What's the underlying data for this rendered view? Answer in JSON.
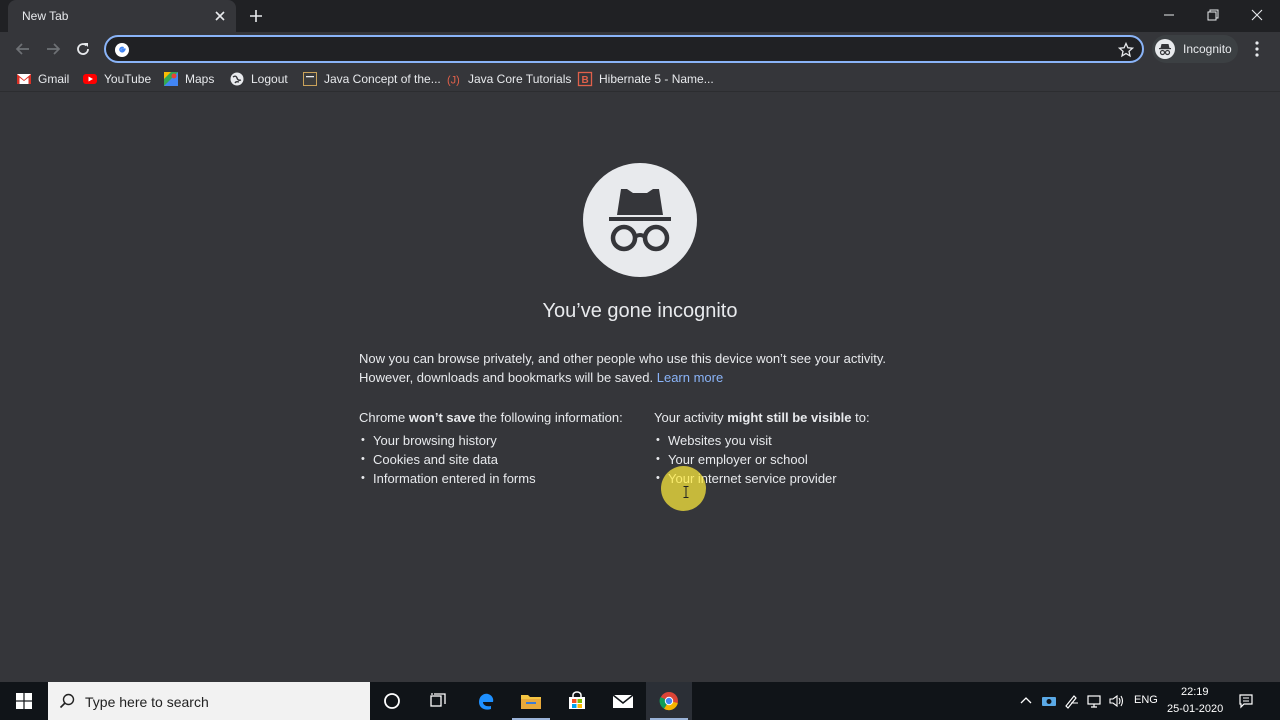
{
  "browser": {
    "tab": {
      "title": "New Tab"
    },
    "profile": {
      "label": "Incognito"
    },
    "omnibox": {
      "value": ""
    },
    "bookmarks": [
      {
        "label": "Gmail",
        "icon": "gmail-icon"
      },
      {
        "label": "YouTube",
        "icon": "youtube-icon"
      },
      {
        "label": "Maps",
        "icon": "maps-icon"
      },
      {
        "label": "Logout",
        "icon": "globe-icon"
      },
      {
        "label": "Java Concept of the...",
        "icon": "bookmark-site-icon"
      },
      {
        "label": "Java Core Tutorials",
        "icon": "bookmark-site-icon"
      },
      {
        "label": "Hibernate 5 - Name...",
        "icon": "bookmark-site-icon"
      }
    ],
    "accent_color": "#8ab4f8"
  },
  "page": {
    "title": "You’ve gone incognito",
    "intro_line1": "Now you can browse privately, and other people who use this device won’t see your activity.",
    "intro_line2": "However, downloads and bookmarks will be saved.",
    "learn_more": "Learn more",
    "left_column": {
      "head_pre": "Chrome ",
      "head_bold": "won’t save",
      "head_post": " the following information:",
      "items": [
        "Your browsing history",
        "Cookies and site data",
        "Information entered in forms"
      ]
    },
    "right_column": {
      "head_pre": "Your activity ",
      "head_bold": "might still be visible",
      "head_post": " to:",
      "items": [
        "Websites you visit",
        "Your employer or school",
        "Your internet service provider"
      ]
    }
  },
  "taskbar": {
    "search_placeholder": "Type here to search",
    "language": "ENG",
    "time": "22:19",
    "date": "25-01-2020"
  }
}
